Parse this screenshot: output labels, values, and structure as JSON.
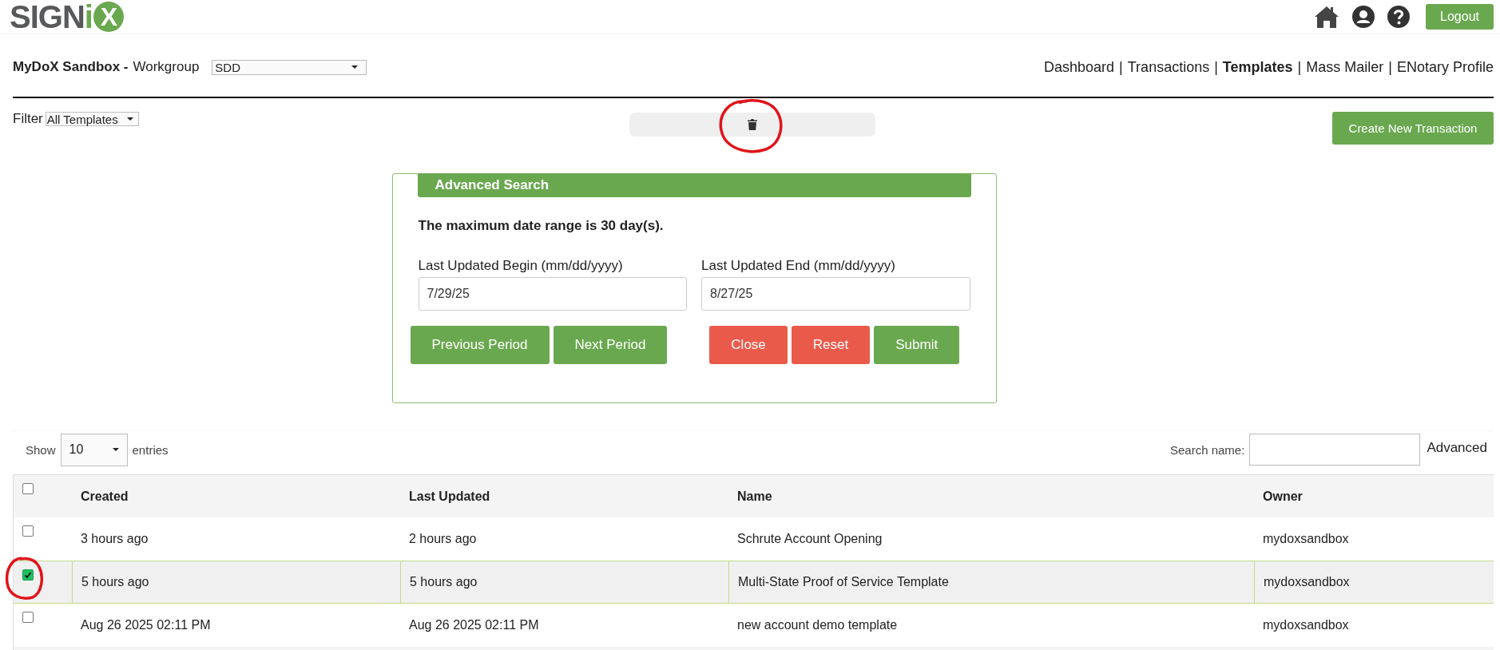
{
  "header": {
    "logo": {
      "text": "SIGN",
      "accent_letter": "i",
      "badge_letter": "X"
    },
    "logout": "Logout"
  },
  "workgroup": {
    "account": "MyDoX Sandbox -",
    "label": "Workgroup",
    "value": "SDD"
  },
  "nav": {
    "separator": "|",
    "items": [
      {
        "label": "Dashboard",
        "selected": false
      },
      {
        "label": "Transactions",
        "selected": false
      },
      {
        "label": "Templates",
        "selected": true
      },
      {
        "label": "Mass Mailer",
        "selected": false
      },
      {
        "label": "ENotary Profile",
        "selected": false
      }
    ]
  },
  "filter": {
    "label": "Filter",
    "value": "All Templates"
  },
  "toolbar": {
    "circled": true
  },
  "create_button": "Create New Transaction",
  "advanced_search": {
    "title": "Advanced Search",
    "note": "The maximum date range is 30 day(s).",
    "fields": [
      {
        "label": "Last Updated Begin (mm/dd/yyyy)",
        "value": "7/29/25"
      },
      {
        "label": "Last Updated End (mm/dd/yyyy)",
        "value": "8/27/25"
      }
    ],
    "buttons": [
      {
        "label": "Previous Period",
        "kind": "primary"
      },
      {
        "label": "Next Period",
        "kind": "primary"
      },
      {
        "label": "Close",
        "kind": "danger"
      },
      {
        "label": "Reset",
        "kind": "danger"
      },
      {
        "label": "Submit",
        "kind": "primary"
      }
    ]
  },
  "table_controls": {
    "show_label": "Show",
    "page_size": "10",
    "entries_label": "entries",
    "search_label": "Search name:",
    "advanced_link": "Advanced"
  },
  "table": {
    "header_checked": false,
    "columns": [
      "Created",
      "Last Updated",
      "Name",
      "Owner"
    ],
    "rows": [
      {
        "checked": false,
        "selected": false,
        "circled": false,
        "cells": [
          "3 hours ago",
          "2 hours ago",
          "Schrute Account Opening",
          "mydoxsandbox"
        ]
      },
      {
        "checked": true,
        "selected": true,
        "circled": true,
        "cells": [
          "5 hours ago",
          "5 hours ago",
          "Multi-State Proof of Service Template",
          "mydoxsandbox"
        ]
      },
      {
        "checked": false,
        "selected": false,
        "circled": false,
        "cells": [
          "Aug 26 2025 02:11 PM",
          "Aug 26 2025 02:11 PM",
          "new account demo template",
          "mydoxsandbox"
        ]
      }
    ]
  }
}
